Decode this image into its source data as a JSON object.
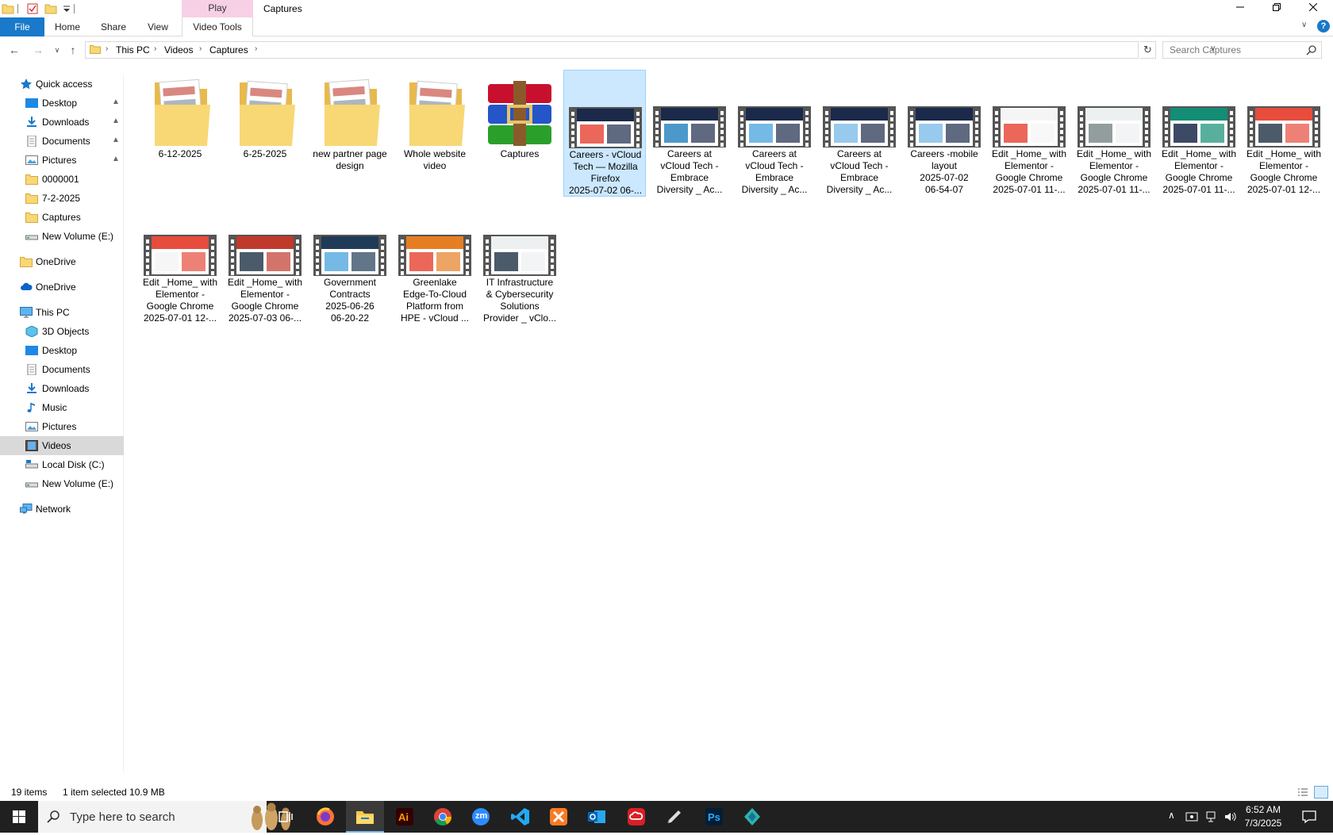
{
  "window": {
    "title": "Captures",
    "context_tab": "Play",
    "ribbon_tabs": {
      "file": "File",
      "home": "Home",
      "share": "Share",
      "view": "View",
      "video_tools": "Video Tools"
    },
    "help": "?"
  },
  "address": {
    "crumbs": [
      "This PC",
      "Videos",
      "Captures"
    ],
    "search_placeholder": "Search Captures"
  },
  "sidebar": {
    "quick_access": "Quick access",
    "quick_items": [
      "Desktop",
      "Downloads",
      "Documents",
      "Pictures",
      "0000001",
      "7-2-2025",
      "Captures",
      "New Volume (E:)"
    ],
    "onedrive1": "OneDrive",
    "onedrive2": "OneDrive",
    "this_pc": "This PC",
    "pc_items": [
      "3D Objects",
      "Desktop",
      "Documents",
      "Downloads",
      "Music",
      "Pictures",
      "Videos",
      "Local Disk (C:)",
      "New Volume (E:)"
    ],
    "network": "Network",
    "selected": "Videos"
  },
  "files": [
    {
      "kind": "folder",
      "lines": [
        "6-12-2025"
      ]
    },
    {
      "kind": "folder",
      "lines": [
        "6-25-2025"
      ]
    },
    {
      "kind": "folder",
      "lines": [
        "new partner page",
        "design"
      ]
    },
    {
      "kind": "folder",
      "lines": [
        "Whole website",
        "video"
      ]
    },
    {
      "kind": "archive",
      "lines": [
        "Captures"
      ]
    },
    {
      "kind": "video",
      "lines": [
        "Careers - vCloud",
        "Tech — Mozilla",
        "Firefox",
        "2025-07-02 06-..."
      ],
      "selected": true
    },
    {
      "kind": "video",
      "lines": [
        "Careers at",
        "vCloud Tech -",
        "Embrace",
        "Diversity _ Ac..."
      ]
    },
    {
      "kind": "video",
      "lines": [
        "Careers at",
        "vCloud Tech -",
        "Embrace",
        "Diversity _ Ac..."
      ]
    },
    {
      "kind": "video",
      "lines": [
        "Careers at",
        "vCloud Tech -",
        "Embrace",
        "Diversity _ Ac..."
      ]
    },
    {
      "kind": "video",
      "lines": [
        "Careers -mobile",
        "layout",
        "2025-07-02",
        "06-54-07"
      ]
    },
    {
      "kind": "video",
      "lines": [
        "Edit _Home_ with",
        "Elementor -",
        "Google Chrome",
        "2025-07-01 11-..."
      ]
    },
    {
      "kind": "video",
      "lines": [
        "Edit _Home_ with",
        "Elementor -",
        "Google Chrome",
        "2025-07-01 11-..."
      ]
    },
    {
      "kind": "video",
      "lines": [
        "Edit _Home_ with",
        "Elementor -",
        "Google Chrome",
        "2025-07-01 11-..."
      ]
    },
    {
      "kind": "video",
      "lines": [
        "Edit _Home_ with",
        "Elementor -",
        "Google Chrome",
        "2025-07-01 12-..."
      ]
    },
    {
      "kind": "video",
      "lines": [
        "Edit _Home_ with",
        "Elementor -",
        "Google Chrome",
        "2025-07-01 12-..."
      ]
    },
    {
      "kind": "video",
      "lines": [
        "Edit _Home_ with",
        "Elementor -",
        "Google Chrome",
        "2025-07-03 06-..."
      ]
    },
    {
      "kind": "video",
      "lines": [
        "Government",
        "Contracts",
        "2025-06-26",
        "06-20-22"
      ]
    },
    {
      "kind": "video",
      "lines": [
        "Greenlake",
        "Edge-To-Cloud",
        "Platform from",
        "HPE - vCloud ..."
      ]
    },
    {
      "kind": "video",
      "lines": [
        "IT Infrastructure",
        "& Cybersecurity",
        "Solutions",
        "Provider _ vClo..."
      ]
    }
  ],
  "status": {
    "count": "19 items",
    "selected": "1 item selected  10.9 MB"
  },
  "taskbar": {
    "search_placeholder": "Type here to search",
    "apps": [
      "firefox-icon",
      "file-explorer-icon",
      "illustrator-icon",
      "chrome-icon",
      "zoom-icon",
      "vscode-icon",
      "xampp-icon",
      "outlook-icon",
      "creative-cloud-icon",
      "pen-tool-icon",
      "photoshop-icon",
      "app-icon"
    ],
    "illustrator_label": "Ai",
    "photoshop_label": "Ps",
    "zoom_label": "zm",
    "time": "6:52 AM",
    "date": "7/3/2025"
  },
  "colors": {
    "accent": "#1979ca",
    "selection": "#cce8ff",
    "folder": "#f8d775",
    "taskbar": "#202020"
  }
}
